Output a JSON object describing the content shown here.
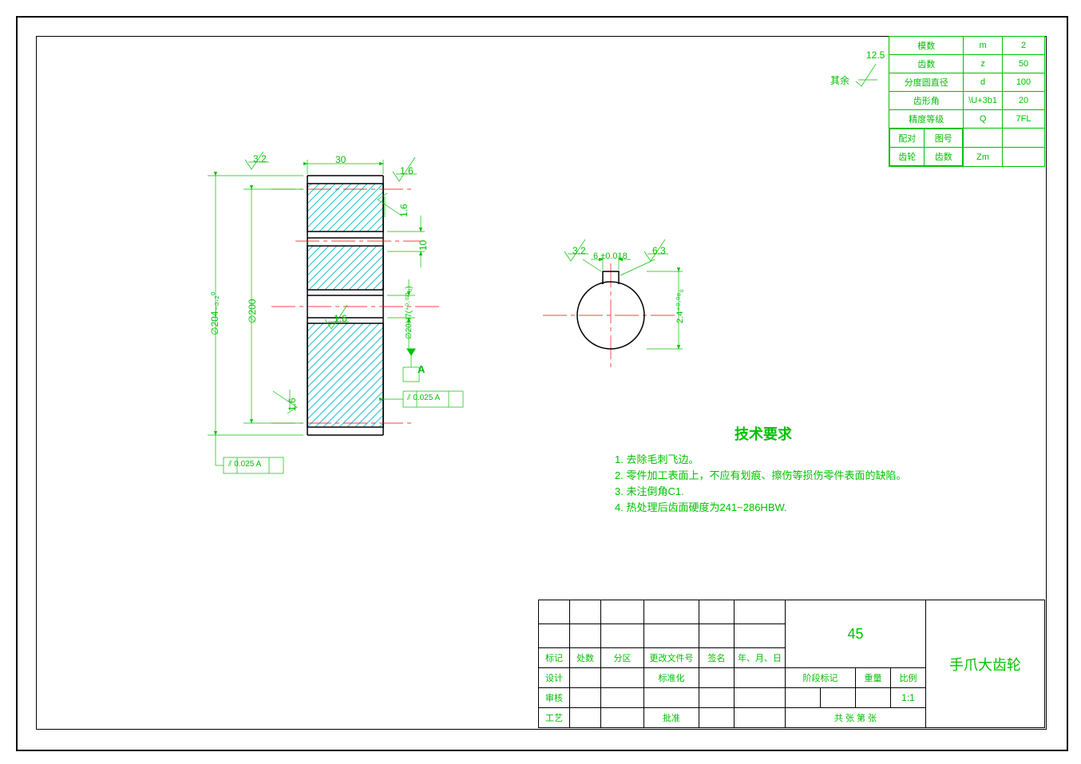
{
  "gear_params": {
    "rows": [
      {
        "name": "模数",
        "symbol": "m",
        "value": "2"
      },
      {
        "name": "齿数",
        "symbol": "z",
        "value": "50"
      },
      {
        "name": "分度圆直径",
        "symbol": "d",
        "value": "100"
      },
      {
        "name": "齿形角",
        "symbol": "\\U+3b1",
        "value": "20"
      },
      {
        "name": "精度等级",
        "symbol": "Q",
        "value": "7FL"
      }
    ],
    "mating": {
      "left_top": "配对",
      "left_bottom": "齿轮",
      "row1_label": "图号",
      "row1_value": "",
      "row2_label": "齿数",
      "row2_symbol": "Zm",
      "row2_value": ""
    }
  },
  "surface_general": {
    "label": "其余",
    "value": "12.5"
  },
  "surface_marks": {
    "top_left": "3.2",
    "top_right": "1.6",
    "bottom_left": "1.6",
    "inner": "1.6",
    "side_small": "1.6",
    "key_left": "3.2",
    "key_right": "6.3"
  },
  "dimensions": {
    "width": "30",
    "dia_outer_tol": "∅204₋₀.₂⁰",
    "dia_pitch": "∅200",
    "dia_bore": "∅20H7(⁺⁰·⁰²¹₀)",
    "step_dim": "10",
    "key_width": "6 ±0.018",
    "key_depth": "2.4⁺⁰·⁰⁸₀"
  },
  "gdnt": {
    "runout_right": "⫽ 0.025 A",
    "runout_bottom": "⫽ 0.025 A",
    "datum": "A"
  },
  "technical": {
    "title": "技术要求",
    "items": [
      "1. 去除毛刺飞边。",
      "2. 零件加工表面上，不应有划痕、擦伤等损伤零件表面的缺陷。",
      "3. 未注倒角C1.",
      "4. 热处理后齿面硬度为241~286HBW."
    ]
  },
  "title_block": {
    "material": "45",
    "part_name": "手爪大齿轮",
    "row_labels": {
      "mark": "标记",
      "count": "处数",
      "zone": "分区",
      "change_doc": "更改文件号",
      "sign": "签名",
      "date": "年、月、日",
      "design": "设计",
      "standardize": "标准化",
      "review": "审核",
      "process": "工艺",
      "approve": "批准",
      "stage_mark": "阶段标记",
      "weight": "重量",
      "scale": "比例",
      "scale_value": "1:1",
      "sheets": "共    张    第    张"
    }
  }
}
